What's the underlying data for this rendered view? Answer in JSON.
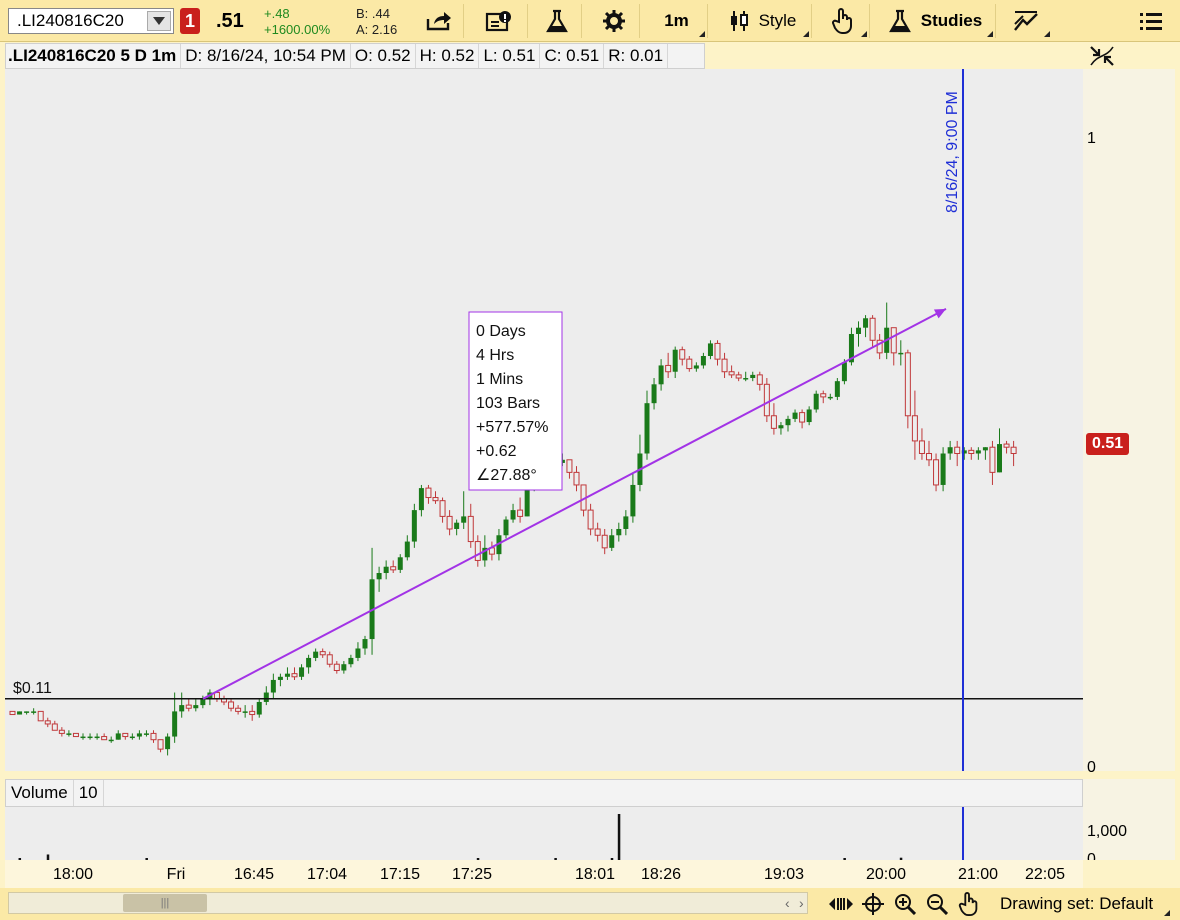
{
  "toolbar": {
    "symbol": ".LI240816C20",
    "alerts_count": "1",
    "last_price": ".51",
    "change_abs": "+.48",
    "change_pct": "+1600.00%",
    "bid": "B: .44",
    "ask": "A: 2.16",
    "interval": "1m",
    "style_label": "Style",
    "studies_label": "Studies"
  },
  "header": {
    "symbol_period": ".LI240816C20 5 D 1m",
    "date": "D: 8/16/24, 10:54 PM",
    "open": "O: 0.52",
    "high": "H: 0.52",
    "low": "L: 0.51",
    "close": "C: 0.51",
    "range": "R: 0.01"
  },
  "price_axis": {
    "tick_1": "1",
    "tick_0": "0",
    "current_badge": "0.51"
  },
  "price_line_label": "$0.11",
  "vertical_line_label": "8/16/24, 9:00 PM",
  "measure_box": [
    "0 Days",
    "4 Hrs",
    "1 Mins",
    "103 Bars",
    "+577.57%",
    "+0.62",
    "∠27.88°"
  ],
  "volume": {
    "label": "Volume",
    "value": "10",
    "tick_1000": "1,000",
    "tick_0": "0"
  },
  "time_labels": [
    "18:00",
    "Fri",
    "16:45",
    "17:04",
    "17:15",
    "17:25",
    "18:01",
    "18:26",
    "19:03",
    "20:00",
    "21:00",
    "22:05"
  ],
  "bottom": {
    "drawing_set": "Drawing set: Default"
  },
  "colors": {
    "up": "#1a7a1a",
    "down": "#c0383a",
    "trendline": "#a233e6",
    "vline": "#1f2fd6",
    "badge": "#c9201c"
  },
  "chart_data": {
    "type": "candlestick",
    "ylim": [
      0,
      1.1
    ],
    "horizontal_line": 0.11,
    "trend_from": 0.11,
    "trend_to": 0.73,
    "candles": [
      [
        0.09,
        0.09,
        0.085,
        0.085
      ],
      [
        0.085,
        0.09,
        0.085,
        0.09
      ],
      [
        0.09,
        0.09,
        0.085,
        0.09
      ],
      [
        0.09,
        0.095,
        0.085,
        0.09
      ],
      [
        0.09,
        0.09,
        0.075,
        0.075
      ],
      [
        0.075,
        0.08,
        0.065,
        0.07
      ],
      [
        0.07,
        0.075,
        0.06,
        0.06
      ],
      [
        0.06,
        0.065,
        0.05,
        0.055
      ],
      [
        0.055,
        0.06,
        0.05,
        0.055
      ],
      [
        0.055,
        0.055,
        0.05,
        0.05
      ],
      [
        0.05,
        0.055,
        0.045,
        0.05
      ],
      [
        0.05,
        0.055,
        0.045,
        0.05
      ],
      [
        0.05,
        0.055,
        0.045,
        0.05
      ],
      [
        0.05,
        0.055,
        0.045,
        0.045
      ],
      [
        0.045,
        0.05,
        0.04,
        0.045
      ],
      [
        0.045,
        0.06,
        0.045,
        0.055
      ],
      [
        0.055,
        0.055,
        0.045,
        0.05
      ],
      [
        0.05,
        0.055,
        0.045,
        0.05
      ],
      [
        0.05,
        0.06,
        0.045,
        0.055
      ],
      [
        0.055,
        0.06,
        0.05,
        0.055
      ],
      [
        0.055,
        0.06,
        0.04,
        0.045
      ],
      [
        0.045,
        0.045,
        0.025,
        0.03
      ],
      [
        0.03,
        0.055,
        0.02,
        0.05
      ],
      [
        0.05,
        0.12,
        0.04,
        0.09
      ],
      [
        0.09,
        0.12,
        0.08,
        0.1
      ],
      [
        0.1,
        0.11,
        0.09,
        0.095
      ],
      [
        0.095,
        0.11,
        0.09,
        0.1
      ],
      [
        0.1,
        0.115,
        0.095,
        0.11
      ],
      [
        0.11,
        0.125,
        0.1,
        0.12
      ],
      [
        0.12,
        0.12,
        0.105,
        0.11
      ],
      [
        0.11,
        0.115,
        0.1,
        0.105
      ],
      [
        0.105,
        0.11,
        0.09,
        0.095
      ],
      [
        0.095,
        0.1,
        0.085,
        0.09
      ],
      [
        0.09,
        0.1,
        0.08,
        0.09
      ],
      [
        0.09,
        0.1,
        0.075,
        0.085
      ],
      [
        0.085,
        0.11,
        0.08,
        0.105
      ],
      [
        0.105,
        0.13,
        0.1,
        0.12
      ],
      [
        0.12,
        0.15,
        0.11,
        0.14
      ],
      [
        0.14,
        0.15,
        0.13,
        0.145
      ],
      [
        0.145,
        0.16,
        0.14,
        0.15
      ],
      [
        0.15,
        0.16,
        0.14,
        0.145
      ],
      [
        0.145,
        0.165,
        0.14,
        0.16
      ],
      [
        0.16,
        0.18,
        0.15,
        0.175
      ],
      [
        0.175,
        0.19,
        0.17,
        0.185
      ],
      [
        0.185,
        0.19,
        0.175,
        0.18
      ],
      [
        0.18,
        0.185,
        0.16,
        0.165
      ],
      [
        0.165,
        0.17,
        0.15,
        0.155
      ],
      [
        0.155,
        0.17,
        0.15,
        0.165
      ],
      [
        0.165,
        0.18,
        0.16,
        0.175
      ],
      [
        0.175,
        0.2,
        0.17,
        0.19
      ],
      [
        0.19,
        0.21,
        0.18,
        0.205
      ],
      [
        0.205,
        0.35,
        0.18,
        0.3
      ],
      [
        0.3,
        0.32,
        0.28,
        0.31
      ],
      [
        0.31,
        0.33,
        0.3,
        0.32
      ],
      [
        0.32,
        0.33,
        0.31,
        0.315
      ],
      [
        0.315,
        0.34,
        0.31,
        0.335
      ],
      [
        0.335,
        0.37,
        0.33,
        0.36
      ],
      [
        0.36,
        0.42,
        0.35,
        0.41
      ],
      [
        0.41,
        0.45,
        0.4,
        0.445
      ],
      [
        0.445,
        0.45,
        0.42,
        0.43
      ],
      [
        0.43,
        0.44,
        0.42,
        0.425
      ],
      [
        0.425,
        0.43,
        0.39,
        0.4
      ],
      [
        0.4,
        0.41,
        0.37,
        0.38
      ],
      [
        0.38,
        0.395,
        0.37,
        0.39
      ],
      [
        0.39,
        0.44,
        0.38,
        0.4
      ],
      [
        0.4,
        0.42,
        0.35,
        0.36
      ],
      [
        0.36,
        0.37,
        0.32,
        0.33
      ],
      [
        0.33,
        0.37,
        0.32,
        0.35
      ],
      [
        0.35,
        0.36,
        0.33,
        0.34
      ],
      [
        0.34,
        0.38,
        0.33,
        0.37
      ],
      [
        0.37,
        0.4,
        0.365,
        0.395
      ],
      [
        0.395,
        0.42,
        0.39,
        0.41
      ],
      [
        0.41,
        0.43,
        0.39,
        0.4
      ],
      [
        0.4,
        0.455,
        0.4,
        0.45
      ],
      [
        0.45,
        0.48,
        0.44,
        0.475
      ],
      [
        0.475,
        0.48,
        0.46,
        0.47
      ],
      [
        0.47,
        0.475,
        0.465,
        0.47
      ],
      [
        0.47,
        0.49,
        0.465,
        0.485
      ],
      [
        0.485,
        0.5,
        0.48,
        0.49
      ],
      [
        0.49,
        0.49,
        0.46,
        0.47
      ],
      [
        0.47,
        0.48,
        0.44,
        0.45
      ],
      [
        0.45,
        0.45,
        0.4,
        0.41
      ],
      [
        0.41,
        0.42,
        0.37,
        0.38
      ],
      [
        0.38,
        0.39,
        0.36,
        0.37
      ],
      [
        0.37,
        0.38,
        0.34,
        0.35
      ],
      [
        0.35,
        0.38,
        0.345,
        0.37
      ],
      [
        0.37,
        0.39,
        0.36,
        0.38
      ],
      [
        0.38,
        0.41,
        0.37,
        0.4
      ],
      [
        0.4,
        0.47,
        0.39,
        0.45
      ],
      [
        0.45,
        0.53,
        0.44,
        0.5
      ],
      [
        0.5,
        0.6,
        0.49,
        0.58
      ],
      [
        0.58,
        0.62,
        0.57,
        0.61
      ],
      [
        0.61,
        0.65,
        0.6,
        0.64
      ],
      [
        0.64,
        0.66,
        0.62,
        0.63
      ],
      [
        0.63,
        0.67,
        0.62,
        0.665
      ],
      [
        0.665,
        0.67,
        0.64,
        0.65
      ],
      [
        0.65,
        0.655,
        0.63,
        0.635
      ],
      [
        0.635,
        0.645,
        0.63,
        0.64
      ],
      [
        0.64,
        0.66,
        0.635,
        0.655
      ],
      [
        0.655,
        0.68,
        0.65,
        0.675
      ],
      [
        0.675,
        0.68,
        0.64,
        0.65
      ],
      [
        0.65,
        0.66,
        0.62,
        0.63
      ],
      [
        0.63,
        0.64,
        0.62,
        0.625
      ],
      [
        0.625,
        0.63,
        0.615,
        0.62
      ],
      [
        0.62,
        0.63,
        0.615,
        0.62
      ],
      [
        0.62,
        0.63,
        0.615,
        0.625
      ],
      [
        0.625,
        0.63,
        0.6,
        0.61
      ],
      [
        0.61,
        0.62,
        0.55,
        0.56
      ],
      [
        0.56,
        0.58,
        0.53,
        0.54
      ],
      [
        0.54,
        0.55,
        0.53,
        0.545
      ],
      [
        0.545,
        0.56,
        0.535,
        0.555
      ],
      [
        0.555,
        0.57,
        0.55,
        0.565
      ],
      [
        0.565,
        0.57,
        0.54,
        0.55
      ],
      [
        0.55,
        0.575,
        0.545,
        0.57
      ],
      [
        0.57,
        0.6,
        0.565,
        0.595
      ],
      [
        0.595,
        0.6,
        0.58,
        0.59
      ],
      [
        0.59,
        0.595,
        0.585,
        0.59
      ],
      [
        0.59,
        0.62,
        0.585,
        0.615
      ],
      [
        0.615,
        0.65,
        0.61,
        0.645
      ],
      [
        0.645,
        0.7,
        0.64,
        0.69
      ],
      [
        0.69,
        0.71,
        0.67,
        0.7
      ],
      [
        0.7,
        0.72,
        0.685,
        0.715
      ],
      [
        0.715,
        0.72,
        0.67,
        0.68
      ],
      [
        0.68,
        0.69,
        0.65,
        0.66
      ],
      [
        0.66,
        0.74,
        0.65,
        0.7
      ],
      [
        0.7,
        0.7,
        0.64,
        0.66
      ],
      [
        0.66,
        0.68,
        0.64,
        0.66
      ],
      [
        0.66,
        0.665,
        0.54,
        0.56
      ],
      [
        0.56,
        0.6,
        0.49,
        0.52
      ],
      [
        0.52,
        0.54,
        0.49,
        0.5
      ],
      [
        0.5,
        0.52,
        0.48,
        0.49
      ],
      [
        0.49,
        0.5,
        0.44,
        0.45
      ],
      [
        0.45,
        0.51,
        0.44,
        0.5
      ],
      [
        0.5,
        0.52,
        0.49,
        0.51
      ],
      [
        0.51,
        0.52,
        0.48,
        0.5
      ],
      [
        0.5,
        0.51,
        0.49,
        0.505
      ],
      [
        0.505,
        0.51,
        0.49,
        0.5
      ],
      [
        0.5,
        0.51,
        0.49,
        0.505
      ],
      [
        0.505,
        0.51,
        0.49,
        0.51
      ],
      [
        0.51,
        0.52,
        0.45,
        0.47
      ],
      [
        0.47,
        0.54,
        0.47,
        0.515
      ],
      [
        0.515,
        0.52,
        0.5,
        0.51
      ],
      [
        0.51,
        0.52,
        0.48,
        0.5
      ]
    ],
    "volume": [
      0,
      40,
      0,
      0,
      0,
      120,
      0,
      0,
      0,
      0,
      0,
      0,
      0,
      0,
      0,
      0,
      0,
      0,
      0,
      40,
      0,
      0,
      0,
      0,
      0,
      0,
      0,
      0,
      0,
      0,
      0,
      0,
      0,
      0,
      0,
      0,
      0,
      0,
      0,
      0,
      0,
      0,
      0,
      0,
      0,
      0,
      0,
      0,
      0,
      0,
      0,
      0,
      0,
      0,
      0,
      0,
      0,
      0,
      0,
      0,
      0,
      0,
      0,
      0,
      0,
      0,
      30,
      0,
      0,
      0,
      0,
      0,
      0,
      0,
      0,
      0,
      0,
      40,
      0,
      0,
      0,
      0,
      0,
      0,
      0,
      20,
      1000,
      0,
      0,
      0,
      0,
      0,
      0,
      0,
      0,
      0,
      0,
      0,
      0,
      0,
      0,
      0,
      0,
      0,
      0,
      0,
      0,
      0,
      0,
      0,
      0,
      0,
      0,
      0,
      0,
      0,
      0,
      0,
      30,
      0,
      0,
      0,
      0,
      0,
      0,
      0,
      50,
      0,
      0,
      0,
      0,
      0,
      0,
      0,
      0,
      0,
      0,
      0,
      0,
      0,
      0,
      0,
      0,
      0,
      0,
      0,
      0,
      0,
      0,
      0,
      0
    ]
  }
}
